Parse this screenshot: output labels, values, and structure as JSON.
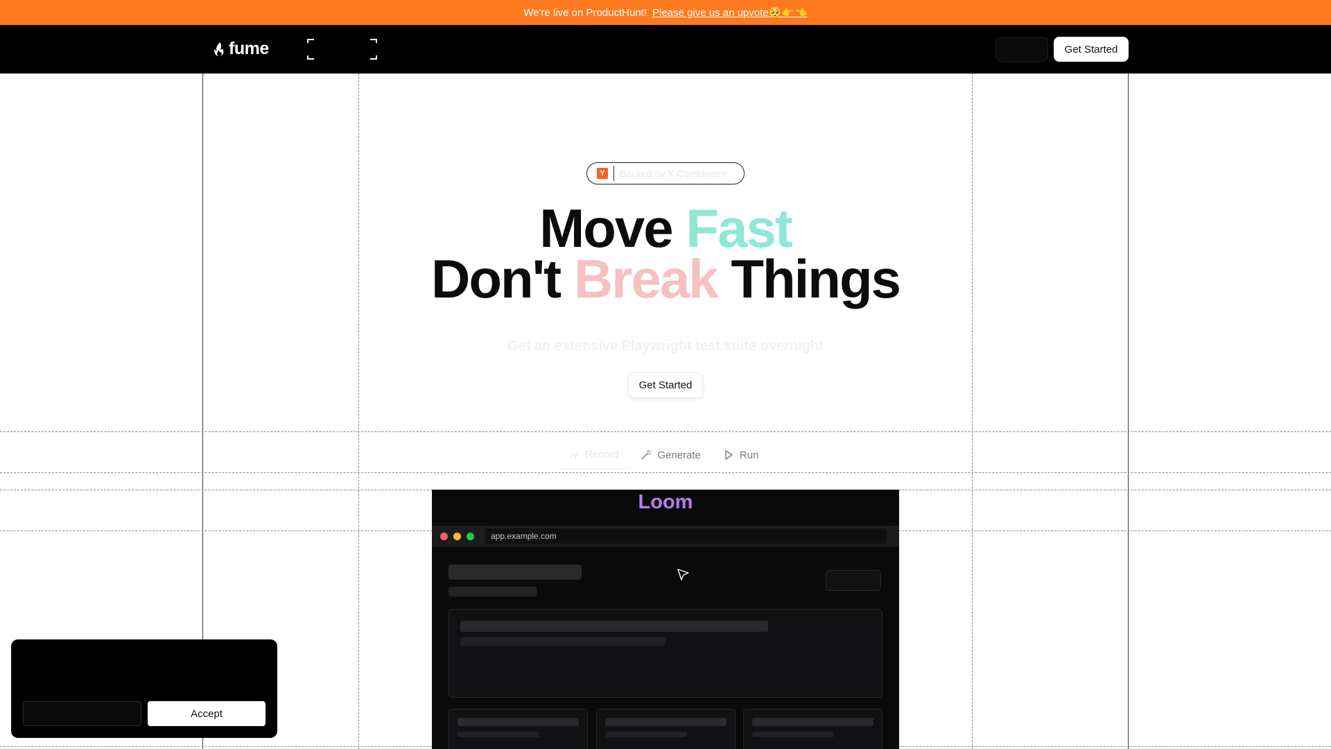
{
  "announcement": {
    "text": "We're live on ProductHunt!",
    "link": "Please give us an upvote🥺👉👈"
  },
  "nav": {
    "logo": "fume",
    "cta": "Get Started"
  },
  "hero": {
    "badge_icon": "Y",
    "badge_text": "Backed by Y Combinator",
    "line1_a": "Move ",
    "line1_b": "Fast",
    "line2_a": "Don't ",
    "line2_b": "Break",
    "line2_c": " Things",
    "subtitle": "Get an extensive Playwright test suite overnight",
    "cta": "Get Started"
  },
  "tabs": [
    {
      "label": "Record",
      "icon": "record-icon"
    },
    {
      "label": "Generate",
      "icon": "wand-icon"
    },
    {
      "label": "Run",
      "icon": "play-icon"
    }
  ],
  "demo": {
    "title": "Loom",
    "url": "app.example.com"
  },
  "cookie": {
    "accept": "Accept"
  },
  "colors": {
    "announce_bg": "#ff7a1f",
    "fast": "#8de8d6",
    "break": "#f6c1c1",
    "loom": "#b57cf0"
  }
}
